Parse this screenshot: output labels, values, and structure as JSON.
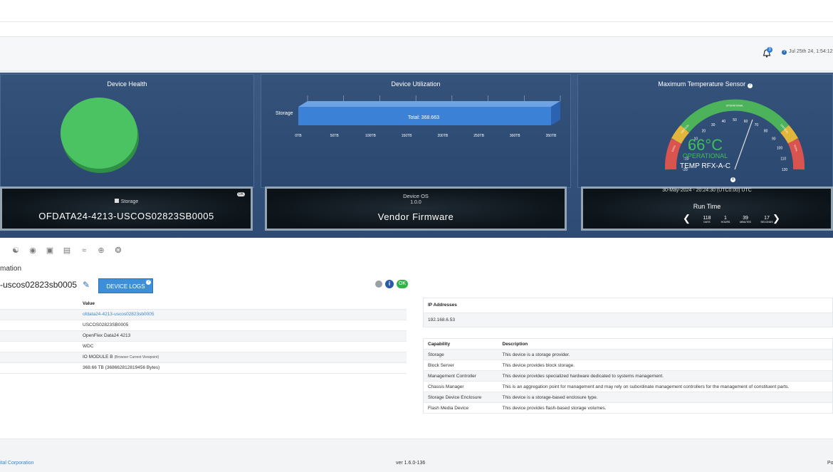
{
  "header": {
    "notification_count": "3",
    "datetime": "Jul 25th 24, 1:54:12"
  },
  "health": {
    "title": "Device Health",
    "color": "#4cc363"
  },
  "utilization": {
    "title": "Device Utilization",
    "row_label": "Storage",
    "total_label": "Total: 368.663",
    "ticks": [
      "0TB",
      "50TB",
      "100TB",
      "150TB",
      "200TB",
      "250TB",
      "300TB",
      "350TB"
    ],
    "bar_color": "#3b82d6"
  },
  "temperature": {
    "title": "Maximum Temperature Sensor",
    "value": "66",
    "unit": "°C",
    "status": "OPERATIONAL",
    "sensor": "TEMP RFX-A-C",
    "scale": [
      "-20",
      "-10",
      "0",
      "10",
      "20",
      "30",
      "40",
      "50",
      "60",
      "70",
      "80",
      "90",
      "100",
      "110",
      "120"
    ],
    "range_labels": [
      "FATAL",
      "CRITICAL",
      "OPERATIONAL",
      "CRITICAL",
      "FATAL"
    ]
  },
  "cards": {
    "storage": {
      "label": "Storage",
      "ok": "OK",
      "name": "OFDATA24-4213-USCOS02823SB0005"
    },
    "os": {
      "label": "Device OS",
      "version": "1.0.0",
      "firmware": "Vendor Firmware"
    },
    "runtime": {
      "date": "30-May-2024 - 20:24:30 (UTC0.00) UTC",
      "title": "Run Time",
      "days": "118",
      "days_label": "DAYS",
      "hours": "1",
      "hours_label": "HOURS",
      "minutes": "39",
      "minutes_label": "MINUTES",
      "seconds": "17",
      "seconds_label": "SECONDS"
    }
  },
  "info": {
    "section": "mation",
    "device_name": "-uscos02823sb0005",
    "logs_button": "DEVICE LOGS",
    "ok": "OK",
    "info_glyph": "i",
    "value_header": "Value",
    "rows": [
      {
        "value": "ofdata24-4213-uscos02823sb0005",
        "note": ""
      },
      {
        "value": "USCOS02823SB0005",
        "note": ""
      },
      {
        "value": "OpenFlex Data24 4213",
        "note": ""
      },
      {
        "value": "WDC",
        "note": ""
      },
      {
        "value": "IO MODULE B",
        "note": "(Browser Current Viewpoint)"
      },
      {
        "value": "368.66 TB (368662812819456 Bytes)",
        "note": ""
      }
    ]
  },
  "ip": {
    "header": "IP Addresses",
    "address": "192.168.6.53"
  },
  "capabilities": {
    "col1": "Capability",
    "col2": "Description",
    "rows": [
      {
        "cap": "Storage",
        "desc": "This device is a storage provider."
      },
      {
        "cap": "Block Server",
        "desc": "This device provides block storage."
      },
      {
        "cap": "Management Controller",
        "desc": "This device provides specialized hardware dedicated to systems management."
      },
      {
        "cap": "Chassis Manager",
        "desc": "This is an aggregation point for management and may rely on subordinate management controllers for the management of constituent parts."
      },
      {
        "cap": "Storage Device Enclosure",
        "desc": "This device is a storage-based enclosure type."
      },
      {
        "cap": "Flash Media Device",
        "desc": "This device provides flash-based storage volumes."
      }
    ]
  },
  "footer": {
    "corp": "ital Corporation",
    "version": "ver 1.6.0-136",
    "right": "Po"
  }
}
